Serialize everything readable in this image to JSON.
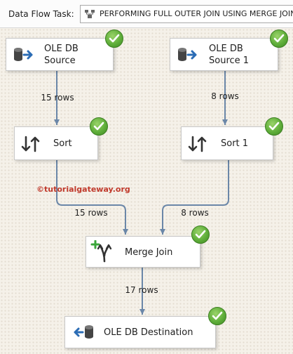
{
  "header": {
    "label": "Data Flow Task:",
    "task_name": "PERFORMING FULL OUTER JOIN USING MERGE JOIN"
  },
  "watermark": "©tutorialgateway.org",
  "nodes": {
    "source1": {
      "line1": "OLE DB",
      "line2": "Source",
      "status": "success",
      "icon": "ole-db-source-icon"
    },
    "source2": {
      "line1": "OLE DB",
      "line2": "Source 1",
      "status": "success",
      "icon": "ole-db-source-icon"
    },
    "sort1": {
      "label": "Sort",
      "status": "success",
      "icon": "sort-icon"
    },
    "sort2": {
      "label": "Sort 1",
      "status": "success",
      "icon": "sort-icon"
    },
    "merge": {
      "label": "Merge Join",
      "status": "success",
      "icon": "merge-join-icon"
    },
    "dest": {
      "label": "OLE DB Destination",
      "status": "success",
      "icon": "ole-db-destination-icon"
    }
  },
  "paths": {
    "source1_to_sort": "15 rows",
    "source2_to_sort1": "8 rows",
    "sort_to_merge": "15 rows",
    "sort1_to_merge": "8 rows",
    "merge_to_dest": "17 rows"
  },
  "colors": {
    "connector": "#6b87a8",
    "success": "#5fae3a",
    "watermark": "#c0392b"
  }
}
